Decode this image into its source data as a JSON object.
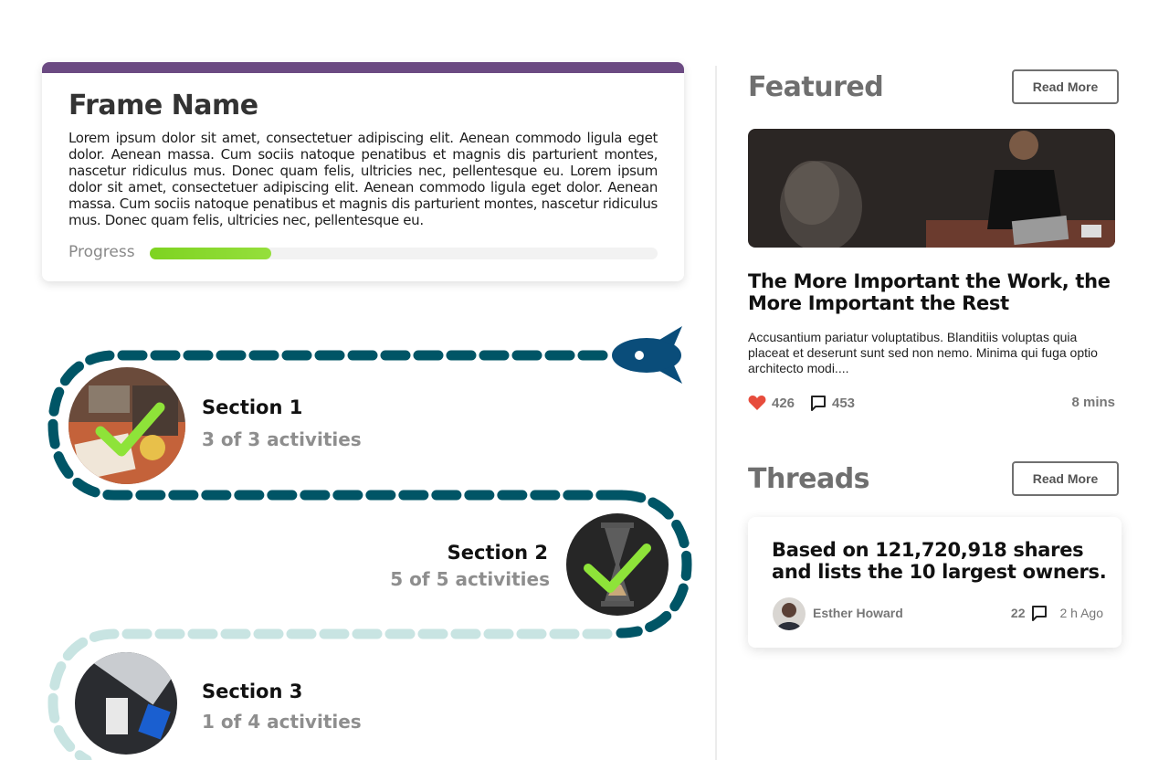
{
  "frame": {
    "title": "Frame Name",
    "body": "Lorem ipsum dolor sit amet, consectetuer adipiscing elit. Aenean commodo ligula eget dolor. Aenean massa. Cum sociis natoque penatibus et magnis dis parturient montes, nascetur ridiculus mus. Donec quam felis, ultricies nec, pellentesque eu. Lorem ipsum dolor sit amet, consectetuer adipiscing elit. Aenean commodo ligula eget dolor. Aenean massa. Cum sociis natoque penatibus et magnis dis parturient montes, nascetur ridiculus mus. Donec quam felis, ultricies nec, pellentesque eu.",
    "progress_label": "Progress",
    "progress_percent": 24
  },
  "sections": [
    {
      "title": "Section 1",
      "subtitle": "3 of 3 activities",
      "completed": true
    },
    {
      "title": "Section 2",
      "subtitle": "5 of 5 activities",
      "completed": true
    },
    {
      "title": "Section 3",
      "subtitle": "1 of 4 activities",
      "completed": false
    }
  ],
  "featured": {
    "heading": "Featured",
    "read_more": "Read More",
    "title": "The More Important the Work, the More Important the Rest",
    "description": "Accusantium pariatur voluptatibus. Blanditiis voluptas quia placeat et deserunt sunt sed non nemo. Minima qui fuga optio architecto modi....",
    "likes": "426",
    "comments": "453",
    "read_time": "8 mins"
  },
  "threads": {
    "heading": "Threads",
    "read_more": "Read More",
    "title": "Based on 121,720,918 shares and lists the 10 largest owners.",
    "author": "Esther Howard",
    "comments": "22",
    "time": "2 h Ago"
  },
  "colors": {
    "path_done": "#005566",
    "path_pending": "#c8e4e2",
    "check": "#8ee339",
    "heart": "#e74c3c",
    "frame_topbar": "#6b4a82"
  },
  "icons": [
    "rocket-icon",
    "check-icon",
    "heart-icon",
    "comment-icon"
  ]
}
